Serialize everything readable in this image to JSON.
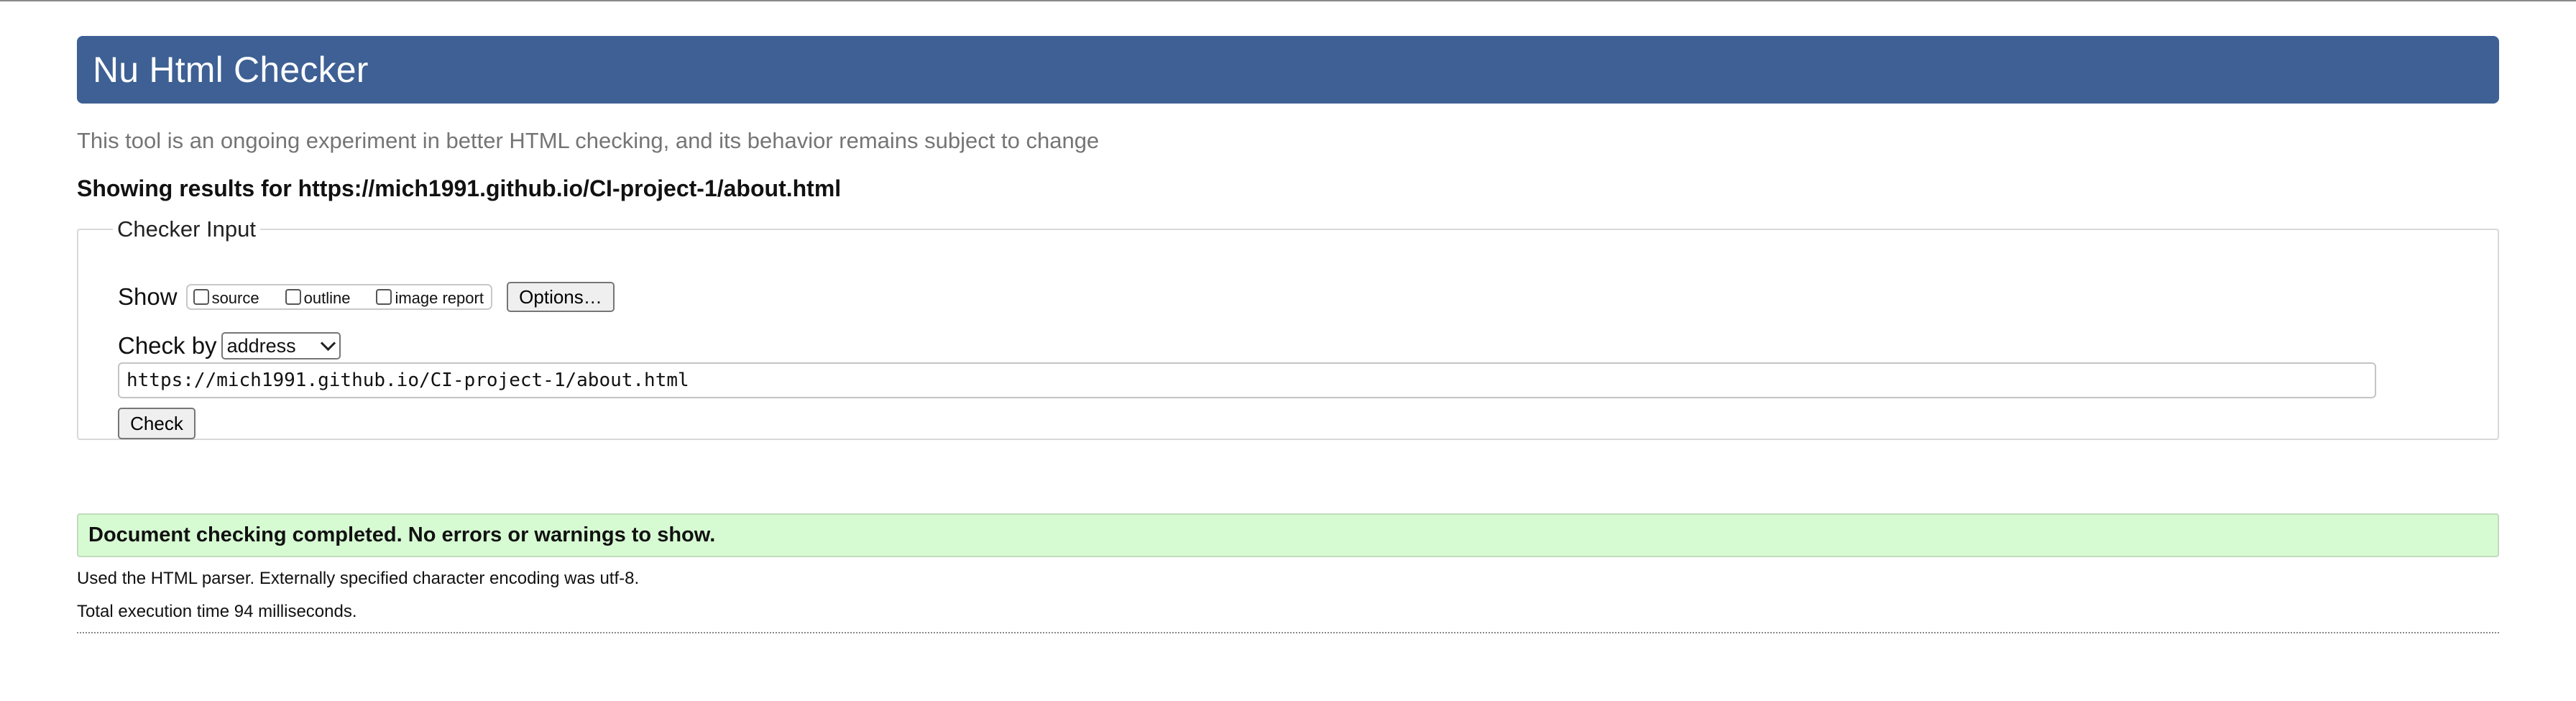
{
  "header": {
    "title": "Nu Html Checker"
  },
  "tagline": "This tool is an ongoing experiment in better HTML checking, and its behavior remains subject to change",
  "showing_results": "Showing results for https://mich1991.github.io/CI-project-1/about.html",
  "checker_input": {
    "legend": "Checker Input",
    "show_label": "Show",
    "show_options": [
      {
        "label": "source",
        "checked": false
      },
      {
        "label": "outline",
        "checked": false
      },
      {
        "label": "image report",
        "checked": false
      }
    ],
    "options_button": "Options…",
    "check_by_label": "Check by",
    "check_by_value": "address",
    "url_value": "https://mich1991.github.io/CI-project-1/about.html",
    "check_button": "Check"
  },
  "result": {
    "message": "Document checking completed. No errors or warnings to show.",
    "parser_note": "Used the HTML parser. Externally specified character encoding was utf-8.",
    "timing_note": "Total execution time 94 milliseconds."
  },
  "colors": {
    "banner": "#3e6094",
    "success_bg": "#d6fbd2",
    "tagline": "#757575"
  }
}
